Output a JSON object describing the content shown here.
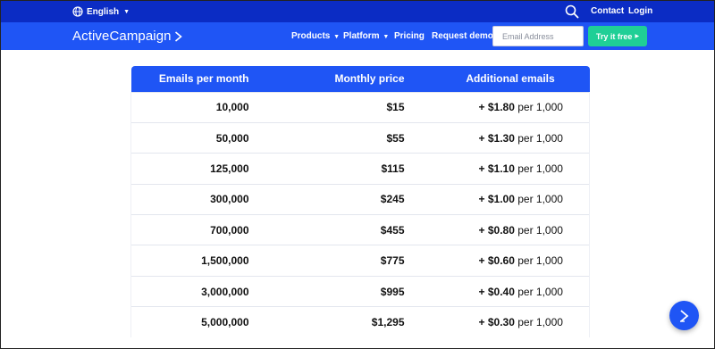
{
  "topbar": {
    "language": "English",
    "links": [
      "Contact",
      "Login"
    ]
  },
  "nav": {
    "logo": "ActiveCampaign",
    "items": [
      {
        "label": "Products",
        "dropdown": true
      },
      {
        "label": "Platform",
        "dropdown": true
      },
      {
        "label": "Pricing",
        "dropdown": false
      },
      {
        "label": "Request demo",
        "dropdown": false
      }
    ],
    "email_placeholder": "Email Address",
    "cta_label": "Try it free"
  },
  "table": {
    "headers": [
      "Emails per month",
      "Monthly price",
      "Additional emails"
    ],
    "rows": [
      {
        "emails": "10,000",
        "price": "$15",
        "extra_amount": "+ $1.80",
        "extra_unit": "per 1,000"
      },
      {
        "emails": "50,000",
        "price": "$55",
        "extra_amount": "+ $1.30",
        "extra_unit": "per 1,000"
      },
      {
        "emails": "125,000",
        "price": "$115",
        "extra_amount": "+ $1.10",
        "extra_unit": "per 1,000"
      },
      {
        "emails": "300,000",
        "price": "$245",
        "extra_amount": "+ $1.00",
        "extra_unit": "per 1,000"
      },
      {
        "emails": "700,000",
        "price": "$455",
        "extra_amount": "+ $0.80",
        "extra_unit": "per 1,000"
      },
      {
        "emails": "1,500,000",
        "price": "$775",
        "extra_amount": "+ $0.60",
        "extra_unit": "per 1,000"
      },
      {
        "emails": "3,000,000",
        "price": "$995",
        "extra_amount": "+ $0.40",
        "extra_unit": "per 1,000"
      },
      {
        "emails": "5,000,000",
        "price": "$1,295",
        "extra_amount": "+ $0.30",
        "extra_unit": "per 1,000"
      }
    ]
  },
  "colors": {
    "topbar_bg": "#0b2cc4",
    "nav_bg": "#1f55f5",
    "cta_bg": "#1fcf96",
    "table_header_bg": "#1f55f5"
  },
  "icons": {
    "language": "globe-icon",
    "search": "search-icon",
    "logo_mark": "chevron-right-icon",
    "chat": "chat-chevron-icon"
  }
}
